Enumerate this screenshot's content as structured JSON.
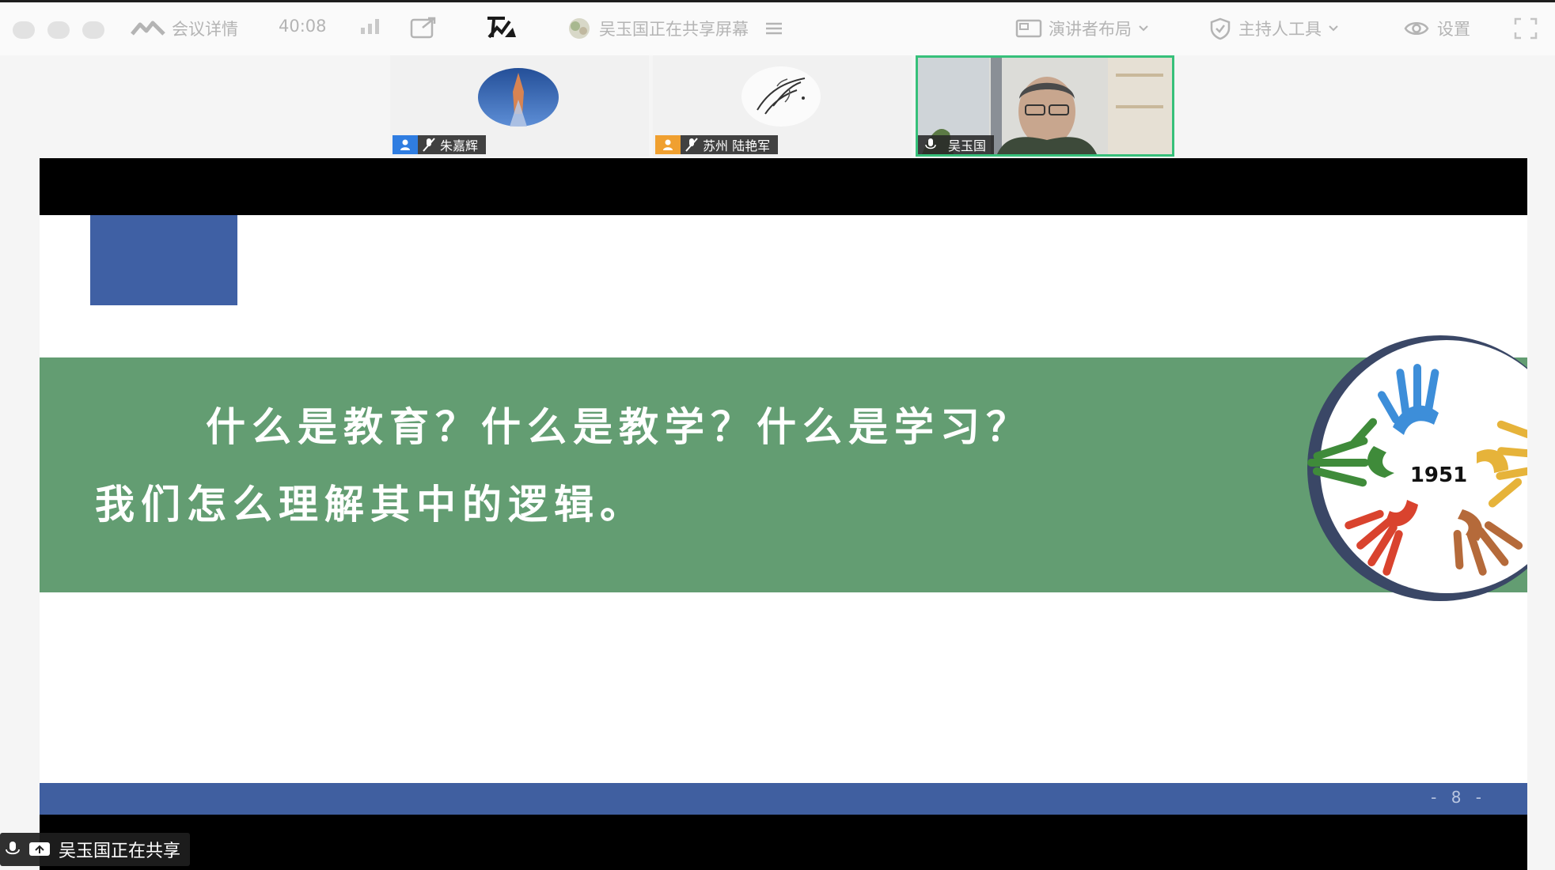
{
  "toolbar": {
    "meeting_details": "会议详情",
    "timer": "40:08",
    "sharing_status": "吴玉国正在共享屏幕",
    "speaker_layout": "演讲者布局",
    "host_tools": "主持人工具",
    "settings": "设置"
  },
  "participants": [
    {
      "name": "朱嘉辉",
      "role_color": "#2f7de1",
      "active": false
    },
    {
      "name": "苏州 陆艳军",
      "role_color": "#f0a030",
      "active": false
    },
    {
      "name": "吴玉国",
      "active": true
    }
  ],
  "slide": {
    "question_line1": "什么是教育？什么是教学？什么是学习？",
    "question_line2": "我们怎么理解其中的逻辑。",
    "logo_year": "1951",
    "page_number": "- 8 -"
  },
  "share_badge": {
    "label": "吴玉国正在共享"
  },
  "colors": {
    "slide_blue": "#3f60a4",
    "slide_green": "#639d72",
    "active_tile_border": "#36c07a",
    "toolbar_text": "#b4b4b4"
  },
  "icons": [
    "meeting-logo-icon",
    "signal-icon",
    "external-link-icon",
    "pen-annotation-icon",
    "share-list-icon",
    "layout-icon",
    "shield-icon",
    "gear-icon",
    "fullscreen-icon",
    "person-icon",
    "mic-muted-icon",
    "screen-share-icon"
  ]
}
